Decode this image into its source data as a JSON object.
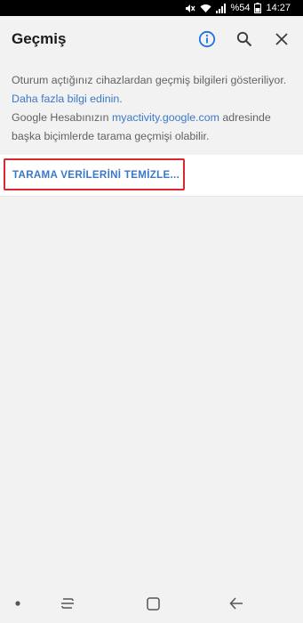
{
  "status_bar": {
    "battery_text": "%54",
    "time": "14:27",
    "icons": [
      "mute-icon",
      "wifi-icon",
      "signal-icon",
      "battery-icon"
    ]
  },
  "app_bar": {
    "title": "Geçmiş",
    "actions": [
      "info-icon",
      "search-icon",
      "close-icon"
    ],
    "accent_color": "#1a73e8"
  },
  "info": {
    "line1_prefix": "Oturum açtığınız cihazlardan geçmiş bilgileri gösteriliyor. ",
    "line1_link": "Daha fazla bilgi edinin",
    "line1_suffix": ".",
    "line2_prefix": "Google Hesabınızın ",
    "line2_link": "myactivity.google.com",
    "line2_suffix": " adresinde başka biçimlerde tarama geçmişi olabilir."
  },
  "clear_button": {
    "label": "TARAMA VERİLERİNİ TEMİZLE...",
    "highlight_color": "#d9272f",
    "text_color": "#3b78c8"
  },
  "nav_bar": {
    "items": [
      "dot-icon",
      "recents-icon",
      "home-icon",
      "back-icon"
    ]
  }
}
